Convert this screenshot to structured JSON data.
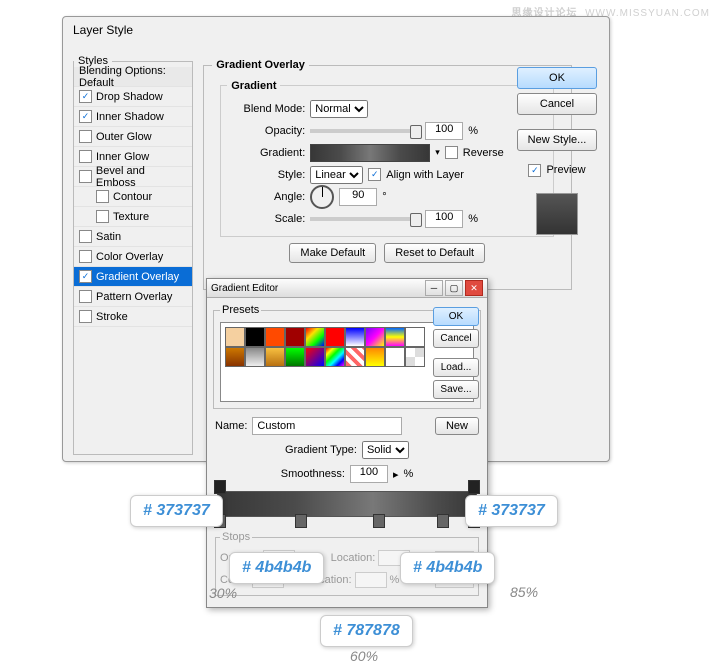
{
  "watermark": {
    "cn": "思缘设计论坛",
    "url": "WWW.MISSYUAN.COM"
  },
  "dialog": {
    "title": "Layer Style",
    "styles_legend": "Styles",
    "blending": "Blending Options: Default",
    "items": [
      {
        "label": "Drop Shadow",
        "checked": true
      },
      {
        "label": "Inner Shadow",
        "checked": true
      },
      {
        "label": "Outer Glow",
        "checked": false
      },
      {
        "label": "Inner Glow",
        "checked": false
      },
      {
        "label": "Bevel and Emboss",
        "checked": false
      },
      {
        "label": "Contour",
        "checked": false,
        "sub": true
      },
      {
        "label": "Texture",
        "checked": false,
        "sub": true
      },
      {
        "label": "Satin",
        "checked": false
      },
      {
        "label": "Color Overlay",
        "checked": false
      },
      {
        "label": "Gradient Overlay",
        "checked": true,
        "selected": true
      },
      {
        "label": "Pattern Overlay",
        "checked": false
      },
      {
        "label": "Stroke",
        "checked": false
      }
    ],
    "panel": {
      "legend": "Gradient Overlay",
      "inner_legend": "Gradient",
      "blend_mode": "Blend Mode:",
      "blend_value": "Normal",
      "opacity": "Opacity:",
      "opacity_val": "100",
      "pct": "%",
      "gradient": "Gradient:",
      "reverse": "Reverse",
      "style": "Style:",
      "style_val": "Linear",
      "align": "Align with Layer",
      "angle": "Angle:",
      "angle_val": "90",
      "deg": "°",
      "scale": "Scale:",
      "scale_val": "100",
      "make_default": "Make Default",
      "reset_default": "Reset to Default"
    },
    "right": {
      "ok": "OK",
      "cancel": "Cancel",
      "new_style": "New Style...",
      "preview": "Preview"
    }
  },
  "ge": {
    "title": "Gradient Editor",
    "presets": "Presets",
    "ok": "OK",
    "cancel": "Cancel",
    "load": "Load...",
    "save": "Save...",
    "name_lbl": "Name:",
    "name_val": "Custom",
    "new": "New",
    "type_lbl": "Gradient Type:",
    "type_val": "Solid",
    "smooth_lbl": "Smoothness:",
    "smooth_val": "100",
    "pct": "%",
    "stops_legend": "Stops",
    "opacity": "Opacity:",
    "location": "Location:",
    "delete": "Delete",
    "color": "Color:"
  },
  "notes": {
    "c1": "# 373737",
    "c2": "# 373737",
    "c3": "# 4b4b4b",
    "c4": "# 4b4b4b",
    "c5": "# 787878",
    "p30": "30%",
    "p60": "60%",
    "p85": "85%"
  },
  "swatches": [
    [
      "#f5d0a0",
      "#000",
      "#ff4a00",
      "#a00000",
      "linear-gradient(135deg,#f00,#ffe000,#0f0,#00f)",
      "#f00",
      "linear-gradient(#00f,#fff)",
      "linear-gradient(135deg,#70f,#f0f,#ff0)",
      "linear-gradient(#06f,#ff0,#f0f)",
      "#fff"
    ],
    [
      "linear-gradient(#c70,#830)",
      "linear-gradient(#888,#eee)",
      "linear-gradient(#f7c040,#b87010)",
      "linear-gradient(#0f0,#070)",
      "linear-gradient(135deg,#f00,#00f)",
      "linear-gradient(135deg,#f00,#ff0,#0f0,#0ff,#00f,#f0f)",
      "repeating-linear-gradient(45deg,#f66 0 4px,#fff 4px 8px)",
      "linear-gradient(#f80,#ff0)",
      "#fff",
      "repeating-conic-gradient(#ddd 0 25%,#fff 0 50%)"
    ]
  ]
}
